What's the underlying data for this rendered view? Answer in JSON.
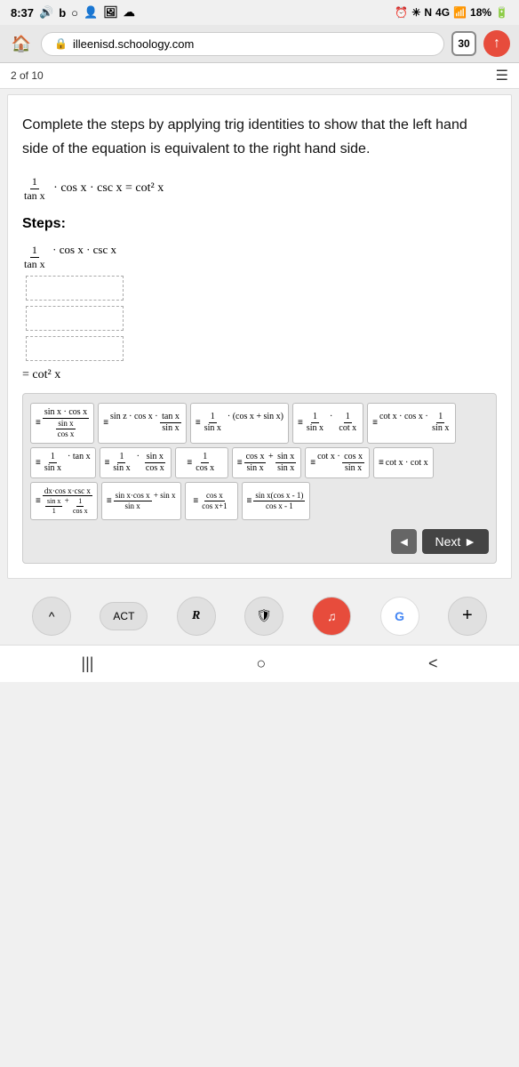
{
  "status_bar": {
    "time": "8:37",
    "battery": "18%",
    "signal": "4G"
  },
  "browser": {
    "url": "illeenisd.schoology.com",
    "tab_count": "30",
    "home_icon": "🏠"
  },
  "page_indicator": {
    "text": "2 of 10",
    "menu_icon": "☰"
  },
  "problem": {
    "description": "Complete the steps by applying trig identities to show that the left hand side of the equation is equivalent to the right hand side.",
    "equation": "1/tan(x) · cos x · csc x = cot² x"
  },
  "steps_label": "Steps:",
  "steps": {
    "first_line": "1/tan(x) · cos x · csc x",
    "blank_boxes": 3,
    "result": "= cot² x"
  },
  "tiles": {
    "row1": [
      "sin x · cos x / (sin x / cos x)",
      "sin z · cos x · (tan x / sin x)",
      "1/sin x · (cos x + sin x)",
      "1/sin x · 1/cot x",
      "cot x · cos x · 1/sin x"
    ],
    "row2": [
      "1/sin x · tan x",
      "1/sin x · sin x / cos x",
      "1/cos x",
      "cos x/sin x + sin x/sin x",
      "cot x · cos x/sin x",
      "cot x · cot x"
    ],
    "row3": [
      "dx·cos x·csc x / (sin x+1/cos x)",
      "sin x·cos x/sin x + sin x",
      "cos x / (cos x+1)",
      "sin x(cos x-1) / (cos x-1)"
    ]
  },
  "navigation": {
    "prev_label": "◄",
    "next_label": "Next ►"
  },
  "bottom_toolbar": {
    "up_icon": "^",
    "act_label": "ACT",
    "rx_label": "R",
    "shield_icon": "🛡",
    "music_icon": "♫",
    "google_icon": "G",
    "plus_icon": "+"
  },
  "system_nav": {
    "menu_icon": "|||",
    "home_icon": "○",
    "back_icon": "<"
  }
}
